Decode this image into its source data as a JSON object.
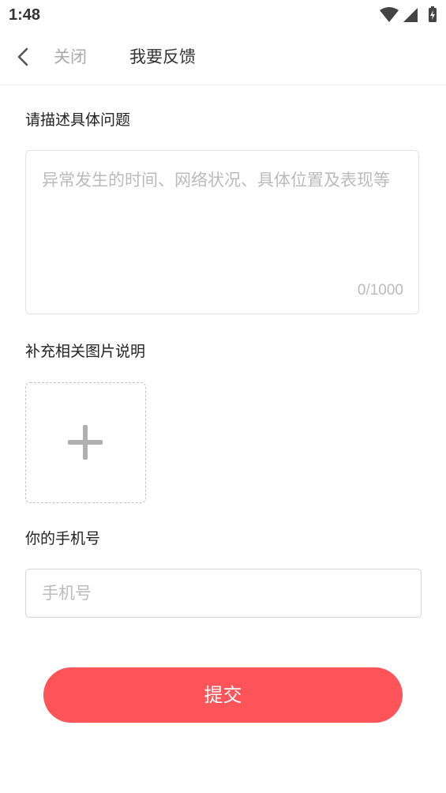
{
  "status_bar": {
    "time": "1:48"
  },
  "nav": {
    "back_icon": "chevron-left-icon",
    "close_label": "关闭",
    "title": "我要反馈"
  },
  "description": {
    "label": "请描述具体问题",
    "placeholder": "异常发生的时间、网络状况、具体位置及表现等",
    "counter": "0/1000"
  },
  "images": {
    "label": "补充相关图片说明",
    "add_icon": "plus-icon"
  },
  "phone": {
    "label": "你的手机号",
    "placeholder": "手机号",
    "value": ""
  },
  "submit": {
    "label": "提交"
  },
  "colors": {
    "accent": "#fc5458",
    "placeholder": "#bbbbbb",
    "border": "#e3e3e3"
  }
}
